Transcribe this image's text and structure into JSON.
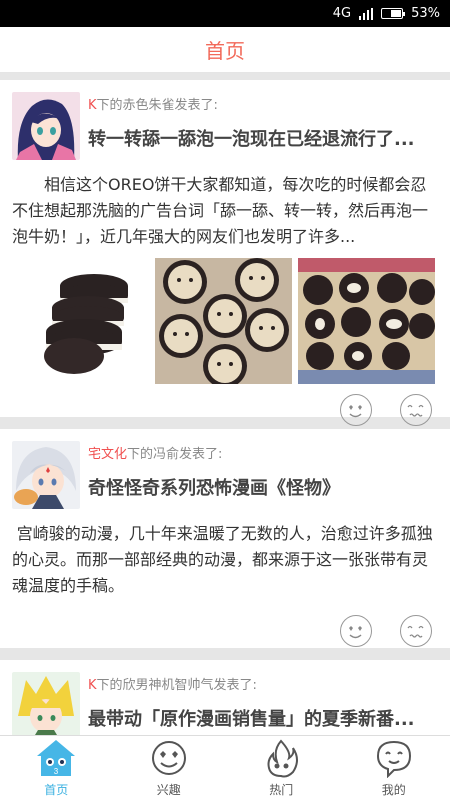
{
  "status_bar": {
    "network": "4G",
    "battery": "53%",
    "battery_level": 0.53
  },
  "header": {
    "title": "首页"
  },
  "posts": [
    {
      "group": "K",
      "byline_rest": "下的赤色朱雀发表了:",
      "title": "转一转舔一舔泡一泡现在已经退流行了...",
      "excerpt": "相信这个OREO饼干大家都知道，每次吃的时候都会忍不住想起那洗脑的广告台词「舔一舔、转一转，然后再泡一泡牛奶！」，近几年强大的网友们也发明了许多..."
    },
    {
      "group": "宅文化",
      "byline_rest": "下的冯俞发表了:",
      "title": "奇怪怪奇系列恐怖漫画《怪物》",
      "excerpt": "宫崎骏的动漫，几十年来温暖了无数的人，治愈过许多孤独的心灵。而那一部部经典的动漫，都来源于这一张张带有灵魂温度的手稿。"
    },
    {
      "group": "K",
      "byline_rest": "下的欣男神机智帅气发表了:",
      "title": "最带动「原作漫画销售量」的夏季新番..."
    }
  ],
  "tabs": [
    {
      "label": "首页",
      "icon": "home-icon",
      "active": true
    },
    {
      "label": "兴趣",
      "icon": "interest-face-icon",
      "active": false
    },
    {
      "label": "热门",
      "icon": "flame-icon",
      "active": false
    },
    {
      "label": "我的",
      "icon": "profile-chat-icon",
      "active": false
    }
  ],
  "colors": {
    "accent": "#f26a5a",
    "group": "#f05050",
    "tab_active": "#39b0e0"
  }
}
